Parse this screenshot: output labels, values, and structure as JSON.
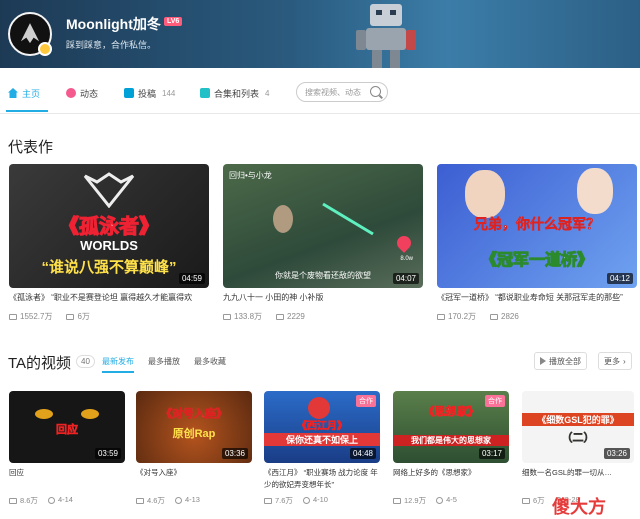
{
  "header": {
    "username": "Moonlight加冬",
    "level": "LV6",
    "signature": "踩到踩意，合作私信。"
  },
  "nav": {
    "items": [
      {
        "label": "主页",
        "count": ""
      },
      {
        "label": "动态",
        "count": ""
      },
      {
        "label": "投稿",
        "count": "144"
      },
      {
        "label": "合集和列表",
        "count": "4"
      }
    ],
    "search_placeholder": "搜索视频、动态"
  },
  "masterpieces": {
    "title": "代表作",
    "videos": [
      {
        "title": "《孤泳者》 “职业不是赛登论坦 赢得越久才能赢得欢",
        "duration": "04:59",
        "views": "1552.7万",
        "danmaku": "6万",
        "thumb_title": "《孤泳者》",
        "thumb_worlds": "WORLDS",
        "thumb_caption": "“谁说八强不算巅峰”"
      },
      {
        "title": "九九八十一 小田的神 小补版",
        "duration": "04:07",
        "views": "133.8万",
        "danmaku": "2229",
        "thumb_top": "回归•与小龙",
        "thumb_caption": "你就是个废物看还敌的欲望",
        "thumb_side": "8.0w"
      },
      {
        "title": "《冠军一道桥》 “都说职业寿命短 关那冠军走的那些”",
        "duration": "04:12",
        "views": "170.2万",
        "danmaku": "2826",
        "thumb_top": "兄弟，你什么冠军？",
        "thumb_caption": "《冠军一道桥》"
      }
    ]
  },
  "ta_videos": {
    "title": "TA的视频",
    "count": "40",
    "tabs": [
      "最新发布",
      "最多播放",
      "最多收藏"
    ],
    "play_all": "播放全部",
    "more": "更多",
    "videos": [
      {
        "title": "回应",
        "duration": "03:59",
        "views": "8.6万",
        "date": "4-14",
        "thumb_text": "回应",
        "tag": ""
      },
      {
        "title": "《对号入座》",
        "duration": "03:36",
        "views": "4.6万",
        "date": "4-13",
        "thumb_text": "《对号入座》",
        "thumb_text2": "原创Rap",
        "tag": ""
      },
      {
        "title": "《西江月》 “职业赛场 战力论度 年少的欲妃弄变想年长”",
        "duration": "04:48",
        "views": "7.6万",
        "date": "4-10",
        "thumb_text": "《西江月》",
        "thumb_text2": "保你还真不如保上",
        "tag": "合作"
      },
      {
        "title": "网络上好多的《思想家》",
        "duration": "03:17",
        "views": "12.9万",
        "date": "4-5",
        "thumb_text": "《思想家》",
        "thumb_text2": "我们都是伟大的思想家",
        "tag": "合作"
      },
      {
        "title": "细数一名GSL的罪一切从…",
        "duration": "03:26",
        "views": "6万",
        "date": "3-28",
        "thumb_text": "《细数GSL犯的罪》",
        "thumb_text2": "（二）",
        "tag": ""
      }
    ]
  },
  "watermark": "傻大方",
  "colors": {
    "accent": "#23ade5",
    "pink": "#fb7299",
    "banner": "#2a5a7e"
  }
}
